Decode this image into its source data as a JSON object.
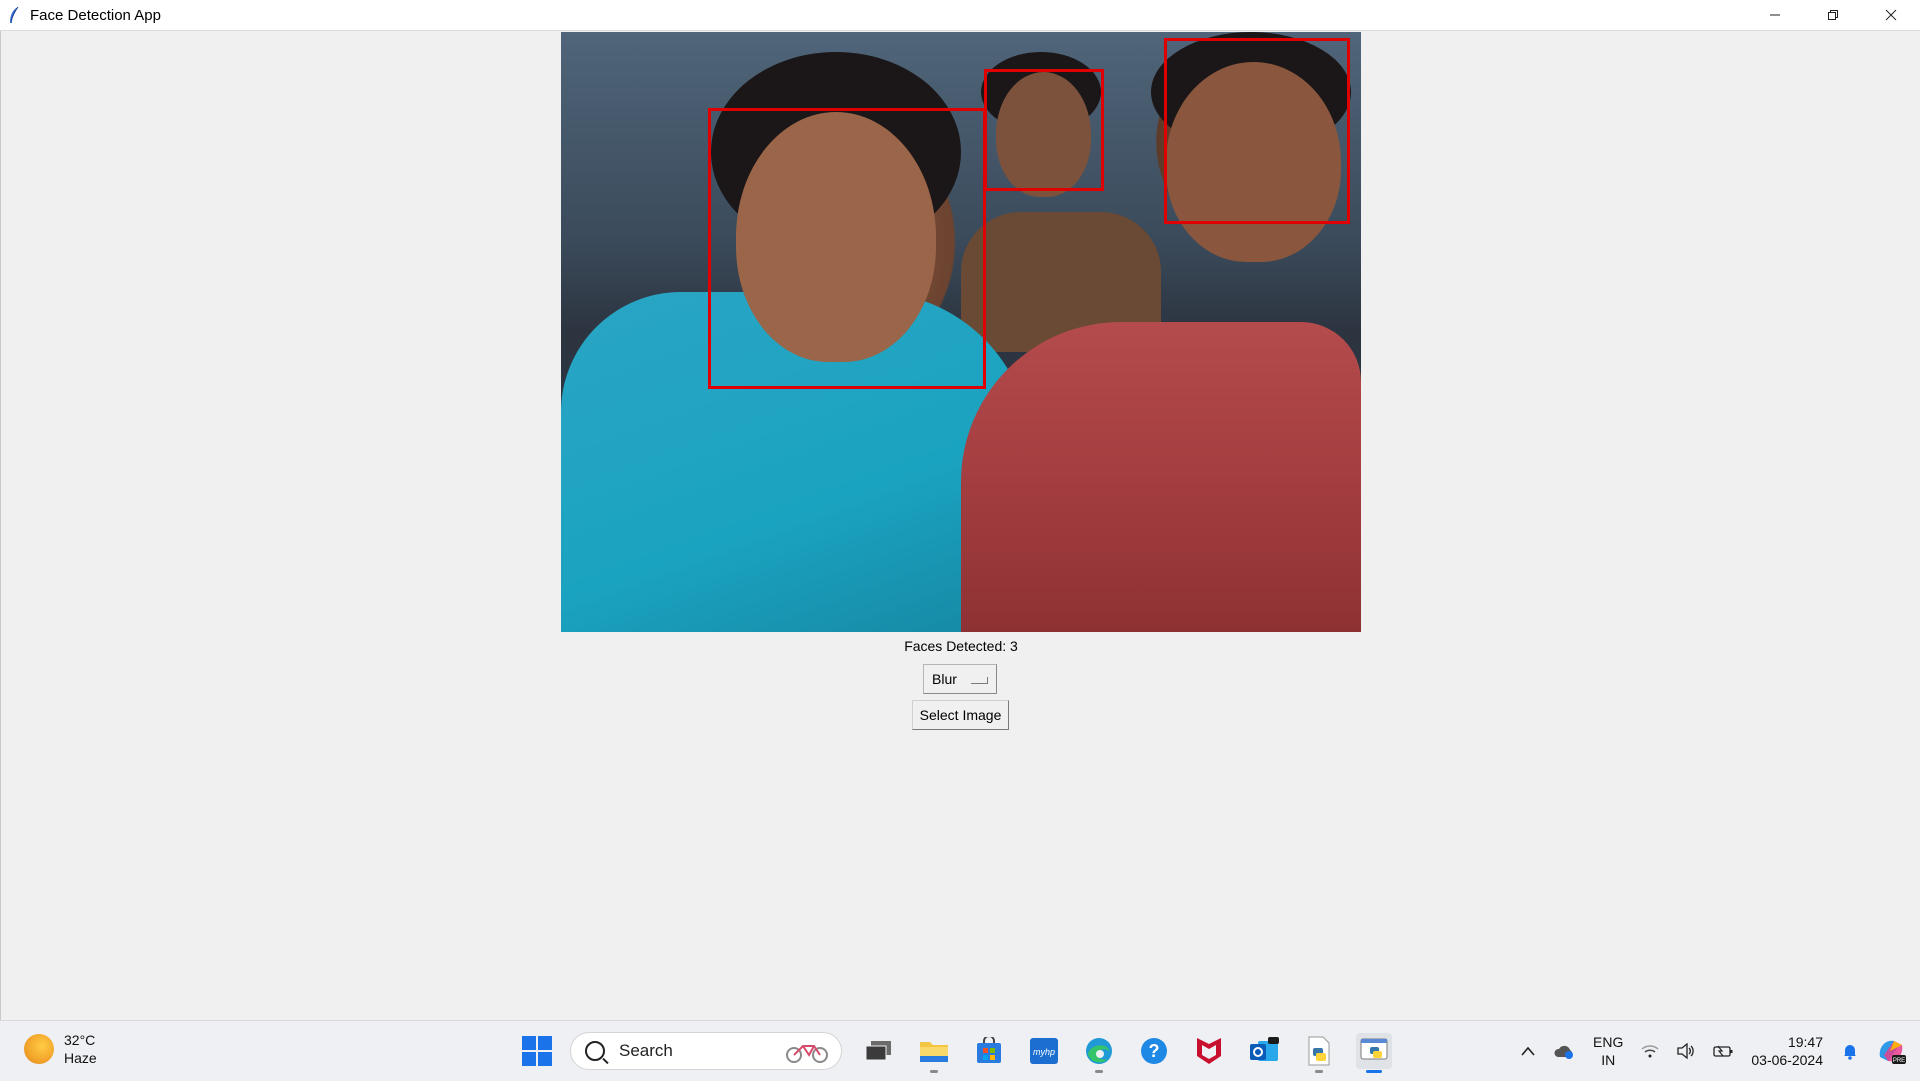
{
  "window": {
    "title": "Face Detection App",
    "controls": {
      "minimize": "—",
      "maximize": "❐",
      "close": "✕"
    }
  },
  "main": {
    "image_alt": "webcam photo with detected faces",
    "faces_label": "Faces Detected: 3",
    "effect_menu": {
      "selected": "Blur",
      "options": [
        "Blur"
      ]
    },
    "select_button": "Select Image",
    "detection_color": "#e00000",
    "detections_count": 3
  },
  "taskbar": {
    "weather": {
      "temp": "32°C",
      "condition": "Haze"
    },
    "search_placeholder": "Search",
    "apps": [
      "start-icon",
      "task-view-icon",
      "file-explorer-icon",
      "microsoft-store-icon",
      "myhp-icon",
      "edge-icon",
      "help-icon",
      "mcafee-icon",
      "outlook-icon",
      "python-file-icon",
      "python-app-icon"
    ],
    "tray": {
      "language_line1": "ENG",
      "language_line2": "IN",
      "time": "19:47",
      "date": "03-06-2024"
    },
    "accent_color": "#1a73e8"
  }
}
